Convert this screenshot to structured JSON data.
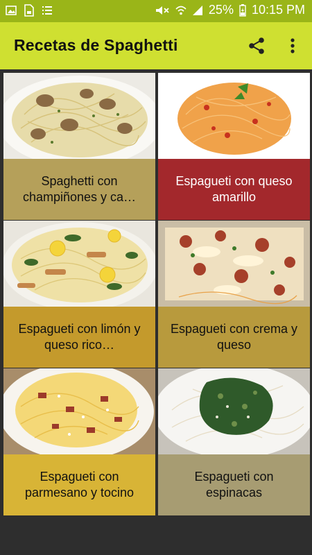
{
  "status_bar": {
    "battery": "25%",
    "time": "10:15 PM",
    "left_icons": [
      "image-icon",
      "document-icon",
      "list-icon"
    ],
    "right_icons": [
      "mute-icon",
      "wifi-icon",
      "signal-icon",
      "battery-icon"
    ]
  },
  "app_bar": {
    "title": "Recetas de Spaghetti",
    "actions": [
      "share-icon",
      "more-vert-icon"
    ],
    "colors": {
      "status": "#9ab518",
      "toolbar": "#cfe031"
    }
  },
  "recipes": [
    {
      "label": "Spaghetti con champiñones y ca…",
      "caption_color": "#b5a05a",
      "text_color": "#111111",
      "image": "creamy mushroom spaghetti"
    },
    {
      "label": "Espagueti con queso amarillo",
      "caption_color": "#a3282c",
      "text_color": "#ffffff",
      "image": "tomato spaghetti with basil"
    },
    {
      "label": "Espagueti con limón y queso rico…",
      "caption_color": "#c49a2c",
      "text_color": "#111111",
      "image": "lemon chicken spaghetti with spinach"
    },
    {
      "label": "Espagueti con crema y queso",
      "caption_color": "#b89a3d",
      "text_color": "#111111",
      "image": "baked spaghetti with cheese"
    },
    {
      "label": "Espagueti con parmesano y tocino",
      "caption_color": "#d8b436",
      "text_color": "#111111",
      "image": "carbonara with bacon"
    },
    {
      "label": "Espagueti con espinacas",
      "caption_color": "#a79c72",
      "text_color": "#111111",
      "image": "spaghetti with spinach pesto"
    }
  ]
}
